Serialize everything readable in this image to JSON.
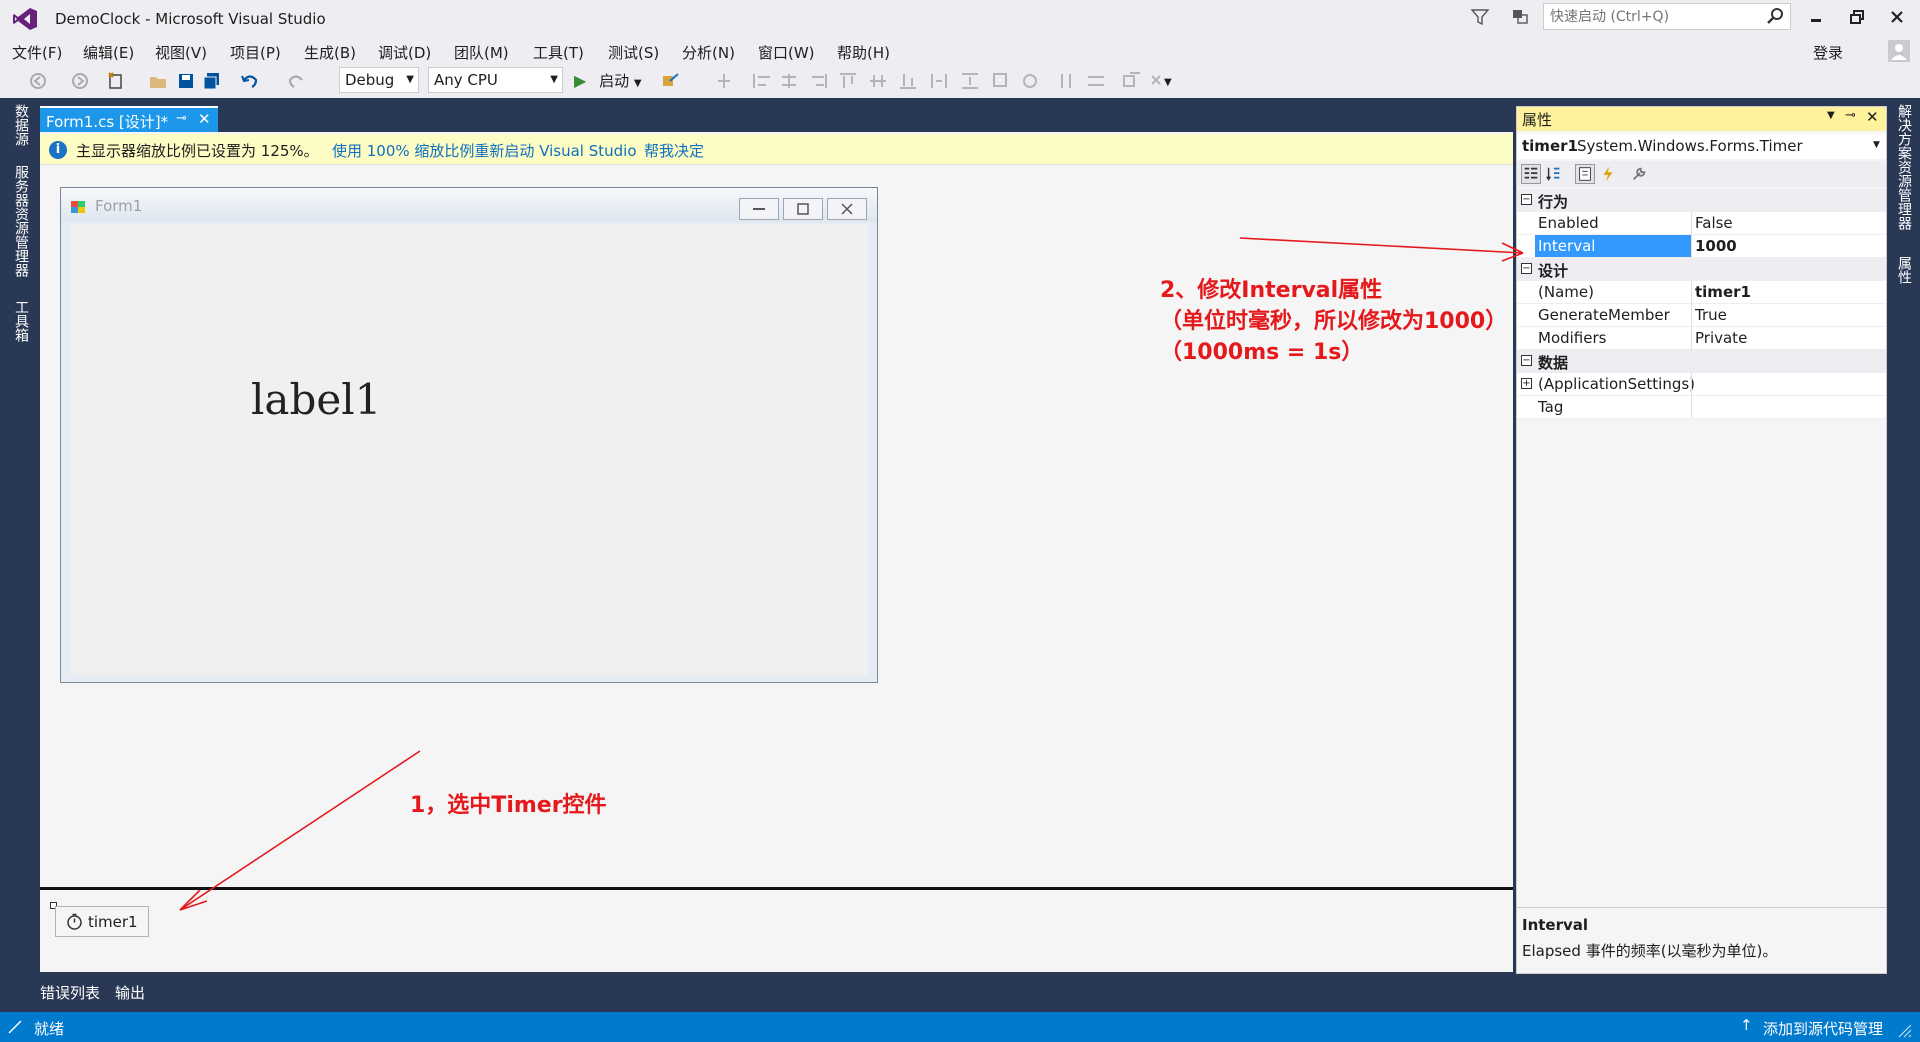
{
  "window": {
    "title": "DemoClock - Microsoft Visual Studio",
    "quick_launch_placeholder": "快速启动 (Ctrl+Q)",
    "login": "登录"
  },
  "menu": [
    "文件(F)",
    "编辑(E)",
    "视图(V)",
    "项目(P)",
    "生成(B)",
    "调试(D)",
    "团队(M)",
    "工具(T)",
    "测试(S)",
    "分析(N)",
    "窗口(W)",
    "帮助(H)"
  ],
  "toolbar": {
    "config": "Debug",
    "platform": "Any CPU",
    "start": "启动"
  },
  "left_tabs": [
    "数据源",
    "服务器资源管理器",
    "工具箱"
  ],
  "right_tabs": [
    "解决方案资源管理器",
    "属性"
  ],
  "document": {
    "tab_title": "Form1.cs [设计]*",
    "infobar": {
      "message": "主显示器缩放比例已设置为 125%。",
      "link1": "使用 100% 缩放比例重新启动 Visual Studio",
      "link2": "帮我决定"
    },
    "form": {
      "title": "Form1",
      "label": "label1"
    },
    "tray": {
      "component": "timer1"
    }
  },
  "bottom_tabs": [
    "错误列表",
    "输出"
  ],
  "status": {
    "left": "就绪",
    "right": "添加到源代码管理"
  },
  "properties": {
    "header": "属性",
    "object_name": "timer1",
    "object_type": "System.Windows.Forms.Timer",
    "categories": [
      {
        "name": "行为",
        "rows": [
          {
            "name": "Enabled",
            "value": "False"
          },
          {
            "name": "Interval",
            "value": "1000"
          }
        ]
      },
      {
        "name": "设计",
        "rows": [
          {
            "name": "(Name)",
            "value": "timer1"
          },
          {
            "name": "GenerateMember",
            "value": "True"
          },
          {
            "name": "Modifiers",
            "value": "Private"
          }
        ]
      },
      {
        "name": "数据",
        "rows": [
          {
            "name": "(ApplicationSettings)",
            "value": ""
          },
          {
            "name": "Tag",
            "value": ""
          }
        ]
      }
    ],
    "desc_title": "Interval",
    "desc_text": "Elapsed 事件的频率(以毫秒为单位)。"
  },
  "annotations": {
    "step1": "1，选中Timer控件",
    "step2_line1": "2、修改Interval属性",
    "step2_line2": "（单位时毫秒，所以修改为1000）",
    "step2_line3": "（1000ms = 1s）"
  },
  "colors": {
    "accent": "#007acc",
    "selection": "#3399ff",
    "annotation": "#e5191b",
    "infobar": "#fefcc5",
    "props_header": "#fff29d"
  }
}
